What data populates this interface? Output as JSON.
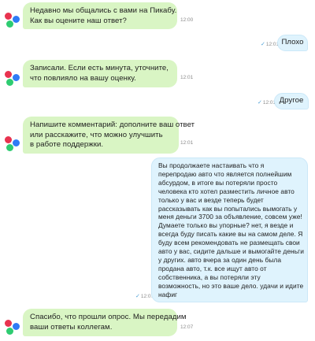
{
  "messages": [
    {
      "sender": "bot",
      "lines": [
        "Недавно мы общались с вами на Пикабу.",
        "Как вы оцените наш ответ?"
      ],
      "time": "12:00"
    },
    {
      "sender": "user",
      "lines": [
        "Плохо"
      ],
      "time": "12:01",
      "read": "✓"
    },
    {
      "sender": "bot",
      "lines": [
        "Записали. Если есть минута, уточните,",
        "что повлияло на вашу оценку."
      ],
      "time": "12:01"
    },
    {
      "sender": "user",
      "lines": [
        "Другое"
      ],
      "time": "12:01",
      "read": "✓"
    },
    {
      "sender": "bot",
      "lines": [
        "Напишите комментарий: дополните ваш ответ",
        "или расскажите, что можно улучшить",
        "в работе поддержки."
      ],
      "time": "12:01"
    },
    {
      "sender": "user",
      "lines": [
        "Вы продолжаете настаивать что я",
        "перепродаю авто что является полнейшим",
        "абсурдом, в итоге вы потеряли просто",
        "человека кто хотел разместить личное авто",
        "только у вас и везде теперь будет",
        "рассказывать как вы попытались вымогать у",
        "меня деньги 3700 за объявление, совсем уже!",
        "Думаете только вы упорные? нет, я везде и",
        "всегда буду писать какие вы на самом деле. Я",
        "буду всем рекомендовать не размещать свои",
        "авто у вас, сидите дальше и вымогайте деньги",
        "у других. авто вчера за один день была",
        "продана авто, т.к. все ищут авто от",
        "собственника, а вы потеряли эту",
        "возможность, но это ваше дело. удачи и идите",
        "нафиг"
      ],
      "time": "12:07",
      "read": "✓"
    },
    {
      "sender": "bot",
      "lines": [
        "Спасибо, что прошли опрос. Мы передадим",
        "ваши ответы коллегам."
      ],
      "time": "12:07"
    }
  ]
}
